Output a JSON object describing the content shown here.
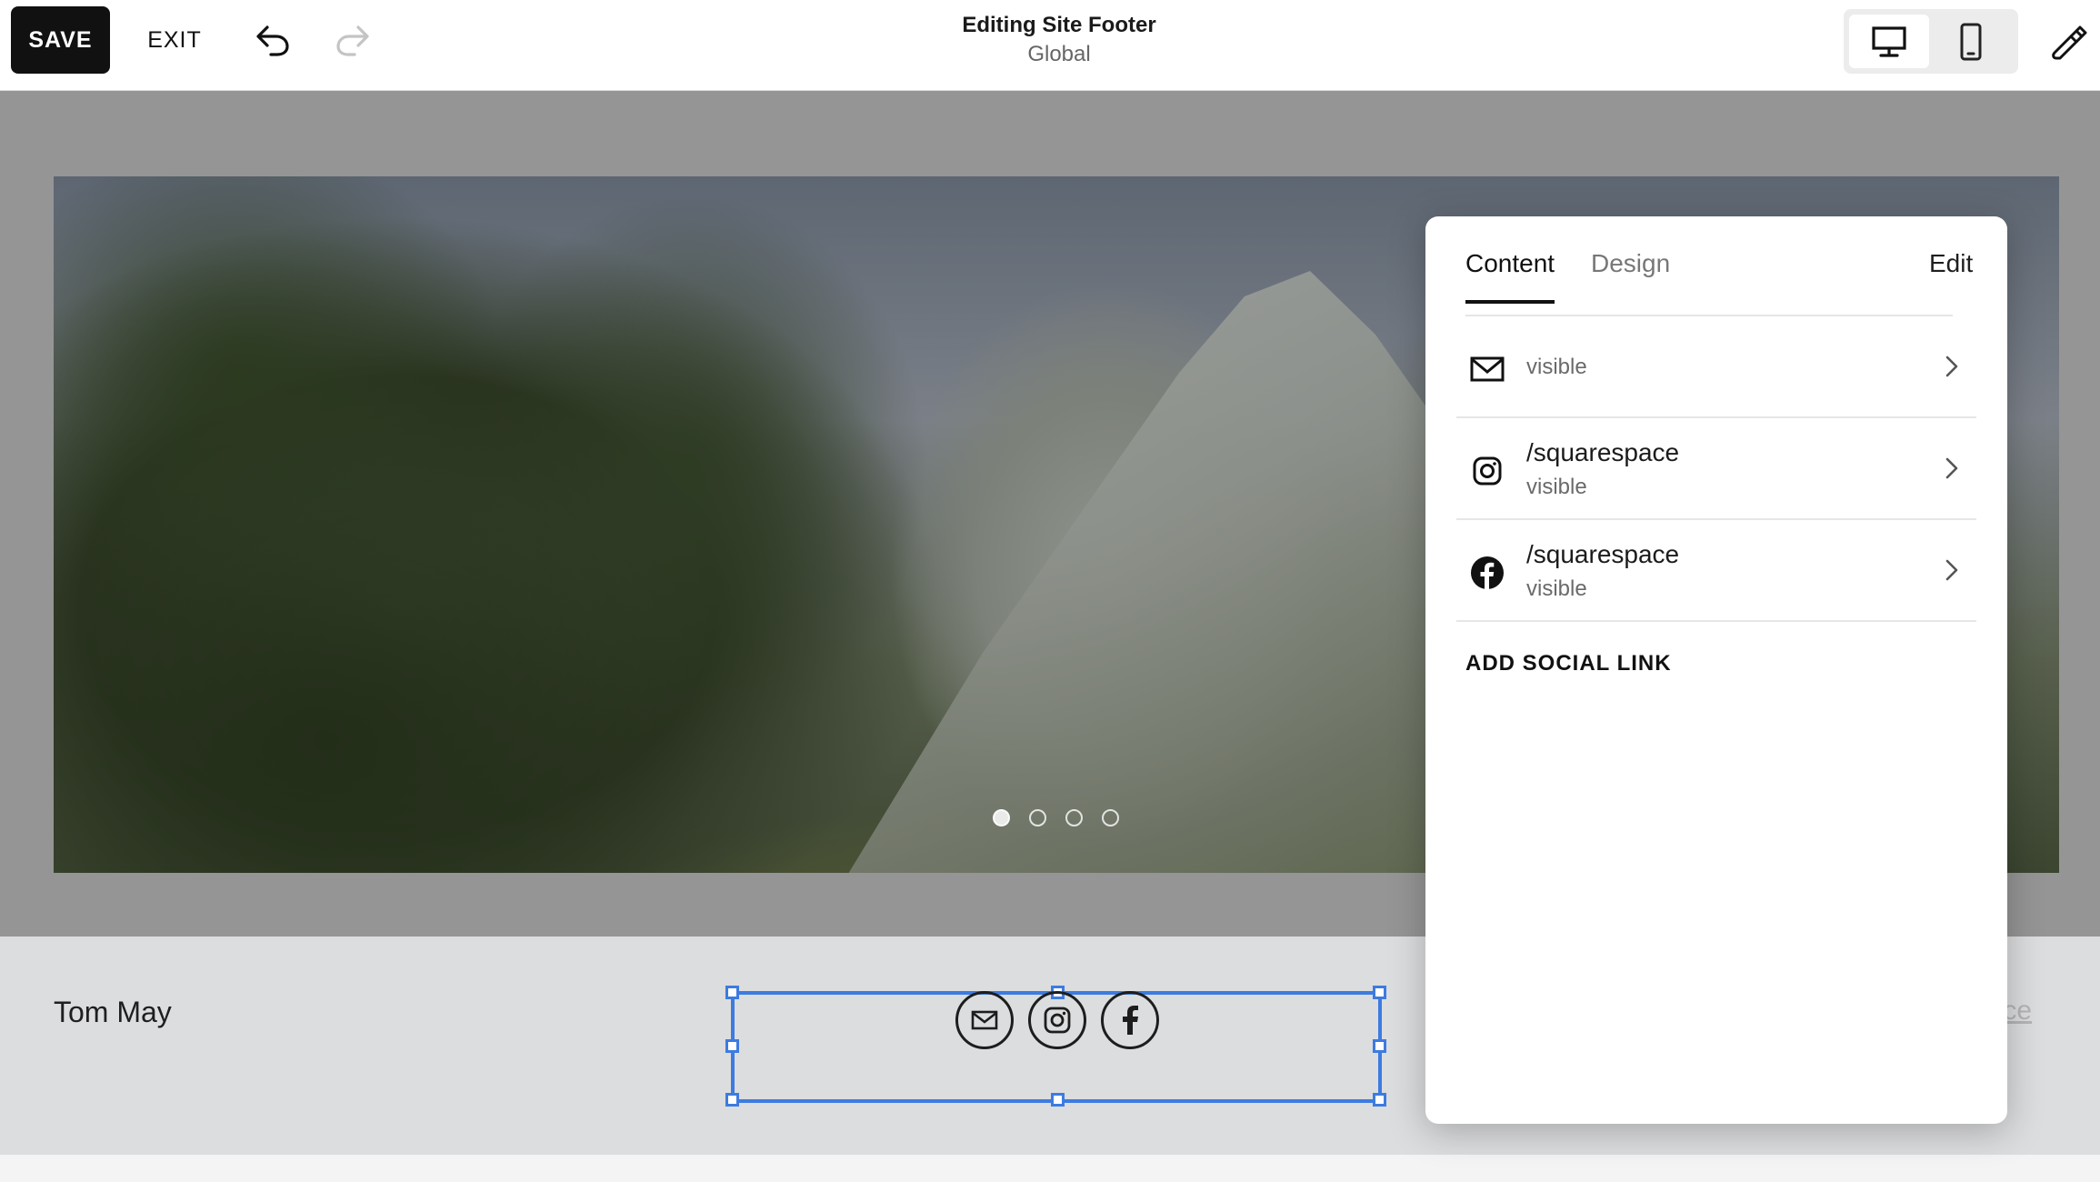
{
  "toolbar": {
    "save_label": "SAVE",
    "exit_label": "EXIT",
    "title": "Editing Site Footer",
    "subtitle": "Global",
    "undo_icon": "undo-icon",
    "redo_icon": "redo-icon",
    "desktop_icon": "desktop-icon",
    "mobile_icon": "mobile-icon",
    "design_icon": "paintbrush-icon"
  },
  "footer": {
    "site_name": "Tom May",
    "link_text": "pace",
    "social_icons": [
      "email-icon",
      "instagram-icon",
      "facebook-icon"
    ]
  },
  "carousel": {
    "slide_count": 4,
    "active_index": 0
  },
  "panel": {
    "tabs": [
      {
        "label": "Content",
        "active": true
      },
      {
        "label": "Design",
        "active": false
      }
    ],
    "edit_label": "Edit",
    "links": [
      {
        "icon": "email-icon",
        "title": "",
        "status": "visible"
      },
      {
        "icon": "instagram-icon",
        "title": "/squarespace",
        "status": "visible"
      },
      {
        "icon": "facebook-icon",
        "title": "/squarespace",
        "status": "visible"
      }
    ],
    "add_label": "ADD SOCIAL LINK"
  },
  "colors": {
    "selection": "#3d7be0",
    "save_bg": "#111111",
    "canvas_overlay": "#959595"
  }
}
